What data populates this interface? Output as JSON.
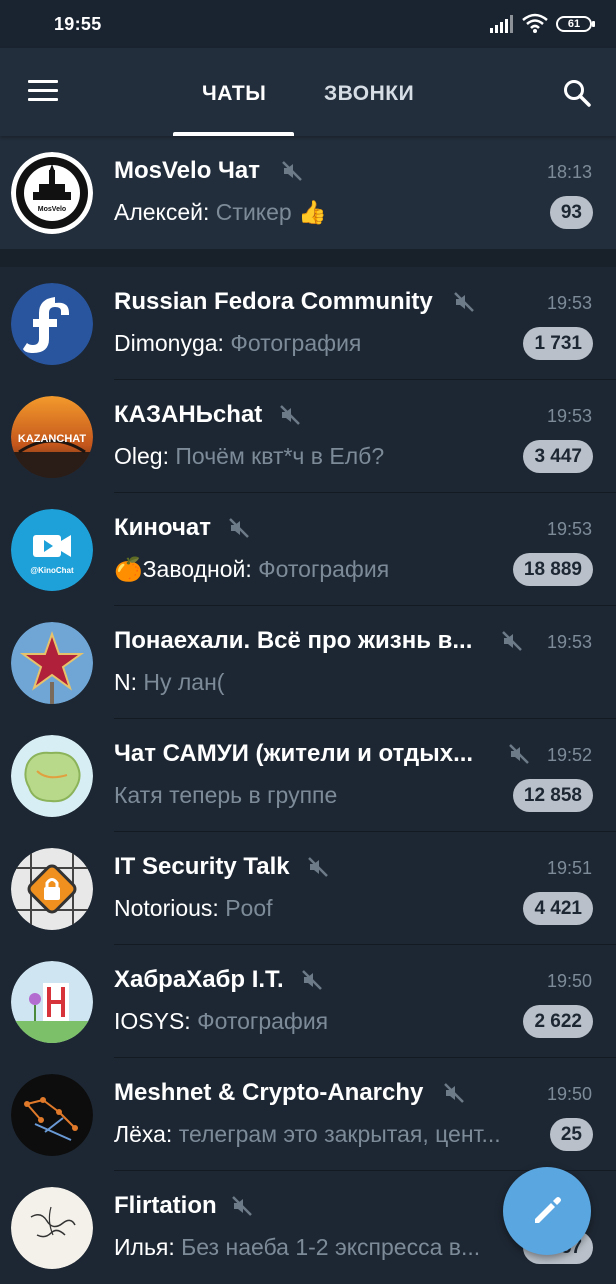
{
  "status_bar": {
    "time": "19:55",
    "battery": "61"
  },
  "tabs": [
    {
      "label": "ЧАТЫ"
    },
    {
      "label": "ЗВОНКИ"
    }
  ],
  "chats": [
    {
      "name": "MosVelo Чат",
      "muted": true,
      "time": "18:13",
      "sender": "Алексей:",
      "text": "Стикер 👍",
      "badge": "93",
      "pinned": true,
      "avatar": "mosvelo-avatar"
    },
    {
      "name": "Russian Fedora Community",
      "muted": true,
      "time": "19:53",
      "sender": "Dimonyga:",
      "text": "Фотография",
      "badge": "1 731",
      "avatar": "fedora-avatar"
    },
    {
      "name": "КАЗАНЬchat",
      "muted": true,
      "time": "19:53",
      "sender": "Oleg:",
      "text": "Почём квт*ч в Елб?",
      "badge": "3 447",
      "avatar": "kazanchat-avatar"
    },
    {
      "name": "Киночат",
      "muted": true,
      "time": "19:53",
      "sender": "🍊Заводной:",
      "text": "Фотография",
      "badge": "18 889",
      "avatar": "kinochat-avatar"
    },
    {
      "name": "Понаехали. Всё про жизнь в...",
      "muted": true,
      "time": "19:53",
      "sender": "N:",
      "text": "Ну лан(",
      "badge": "",
      "avatar": "kremlin-star-avatar"
    },
    {
      "name": "Чат САМУИ (жители и отдых...",
      "muted": true,
      "time": "19:52",
      "sender": "",
      "text": "Катя теперь в группе",
      "badge": "12 858",
      "avatar": "samui-map-avatar"
    },
    {
      "name": "IT Security Talk",
      "muted": true,
      "time": "19:51",
      "sender": "Notorious:",
      "text": "Poof",
      "badge": "4 421",
      "avatar": "lock-avatar"
    },
    {
      "name": "ХабраХабр I.T.",
      "muted": true,
      "time": "19:50",
      "sender": "IOSYS:",
      "text": "Фотография",
      "badge": "2 622",
      "avatar": "habr-avatar"
    },
    {
      "name": "Meshnet & Crypto-Anarchy",
      "muted": true,
      "time": "19:50",
      "sender": "Лёха:",
      "text": "телеграм это закрытая, цент...",
      "badge": "25",
      "avatar": "meshnet-avatar"
    },
    {
      "name": "Flirtation",
      "muted": true,
      "time": "",
      "sender": "Илья:",
      "text": "Без наеба 1-2 экспресса в...",
      "badge": "5 657",
      "avatar": "flirtation-avatar"
    }
  ],
  "colors": {
    "background": "#1d2733",
    "header": "#232e3c",
    "badge": "#b9c0c9",
    "fab": "#5aa6e0",
    "muted_text": "#7d8b99"
  }
}
